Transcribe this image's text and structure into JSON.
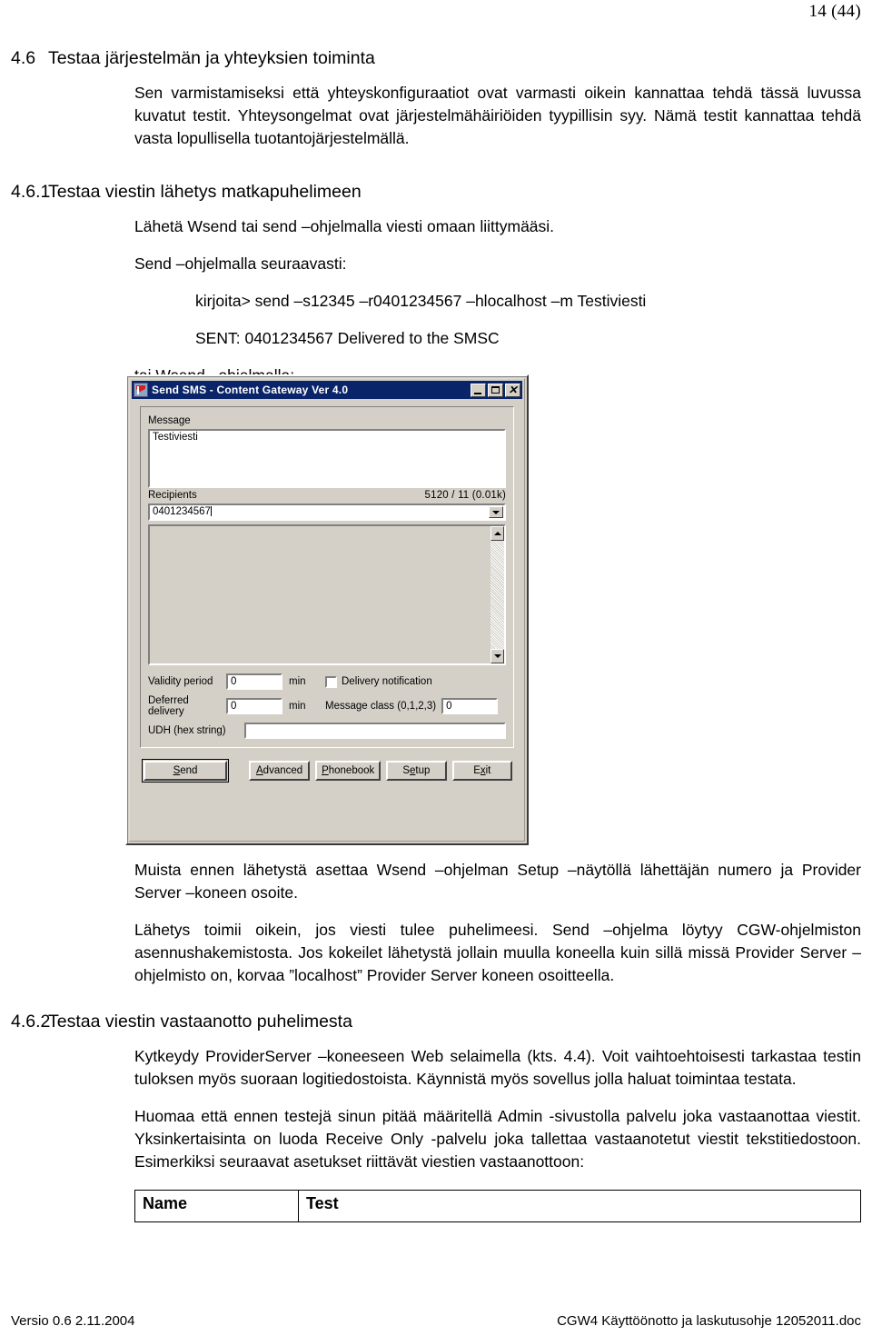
{
  "page": {
    "number_label": "14 (44)",
    "footer_left": "Versio 0.6 2.11.2004",
    "footer_right": "CGW4 Käyttöönotto ja laskutusohje 12052011.doc"
  },
  "sections": {
    "s46": {
      "num": "4.6",
      "title": "Testaa järjestelmän ja yhteyksien toiminta",
      "para1": "Sen varmistamiseksi että yhteyskonfiguraatiot ovat varmasti oikein kannattaa tehdä tässä luvussa kuvatut testit. Yhteysongelmat ovat järjestelmähäiriöiden tyypillisin syy. Nämä testit kannattaa tehdä vasta lopullisella tuotantojärjestelmällä."
    },
    "s461": {
      "num": "4.6.1",
      "title": "Testaa viestin lähetys matkapuhelimeen",
      "para1": "Lähetä Wsend tai send –ohjelmalla viesti omaan liittymääsi.",
      "para2": "Send –ohjelmalla seuraavasti:",
      "cmd1": "kirjoita> send –s12345 –r0401234567 –hlocalhost –m Testiviesti",
      "cmd2": "SENT: 0401234567 Delivered to the SMSC",
      "para3": "tai Wsend –ohjelmalla:",
      "para4": "Muista ennen lähetystä asettaa Wsend –ohjelman Setup –näytöllä lähettäjän numero ja Provider Server –koneen osoite.",
      "para5": "Lähetys toimii oikein, jos viesti tulee puhelimeesi. Send –ohjelma löytyy CGW-ohjelmiston asennushakemistosta. Jos kokeilet lähetystä jollain muulla koneella kuin sillä missä Provider Server –ohjelmisto on, korvaa ”localhost” Provider Server koneen osoitteella."
    },
    "s462": {
      "num": "4.6.2",
      "title": "Testaa viestin vastaanotto puhelimesta",
      "para1": "Kytkeydy ProviderServer –koneeseen Web selaimella (kts. 4.4). Voit vaihtoehtoisesti tarkastaa testin tuloksen myös suoraan logitiedostoista. Käynnistä myös sovellus jolla haluat toimintaa testata.",
      "para2": "Huomaa että ennen testejä sinun pitää määritellä Admin -sivustolla palvelu joka vastaanottaa viestit. Yksinkertaisinta on luoda Receive Only -palvelu joka tallettaa vastaanotetut viestit tekstitiedostoon. Esimerkiksi seuraavat asetukset riittävät viestien vastaanottoon:"
    }
  },
  "settings_table": {
    "rows": [
      {
        "name": "Name",
        "value": "Test"
      }
    ]
  },
  "dialog": {
    "title": "Send SMS - Content Gateway Ver 4.0",
    "icon": "flag-icon",
    "window_buttons": {
      "minimize": "minimize-icon",
      "maximize": "maximize-icon",
      "close": "close-icon"
    },
    "message": {
      "label": "Message",
      "value": "Testiviesti",
      "counter": "5120 / 11 (0.01k)"
    },
    "recipients": {
      "label": "Recipients",
      "value": "0401234567",
      "list_items": []
    },
    "validity_period": {
      "label": "Validity period",
      "value": "0",
      "unit": "min"
    },
    "deferred_delivery": {
      "label": "Deferred delivery",
      "value": "0",
      "unit": "min"
    },
    "delivery_notification": {
      "label": "Delivery notification",
      "checked": false
    },
    "message_class": {
      "label": "Message class (0,1,2,3)",
      "value": "0"
    },
    "udh": {
      "label": "UDH (hex string)",
      "value": ""
    },
    "buttons": {
      "send": "Send",
      "advanced": "Advanced",
      "phonebook": "Phonebook",
      "setup": "Setup",
      "exit": "Exit"
    }
  },
  "colors": {
    "titlebar": "#0a246a",
    "dialog_face": "#d4d0c8",
    "field_bg": "#ffffff"
  }
}
